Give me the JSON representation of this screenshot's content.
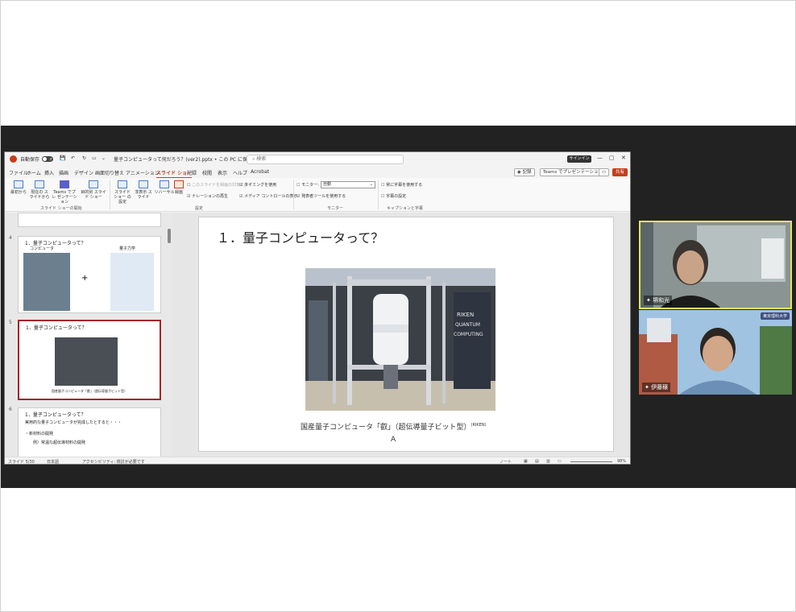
{
  "titlebar": {
    "autosave": "自動保存",
    "autosave_state": "オフ",
    "doc_title": "量子コンピュータって何だろう？(ver2).pptx • この PC に保存済み",
    "search_placeholder": "検索",
    "signin": "サインイン"
  },
  "tabs": [
    "ファイル",
    "ホーム",
    "挿入",
    "描画",
    "デザイン",
    "画面切り替え",
    "アニメーション",
    "スライド ショー",
    "記録",
    "校閲",
    "表示",
    "ヘルプ",
    "Acrobat"
  ],
  "tab_buttons": {
    "record": "記録",
    "teams": "Teams でプレゼンテーション",
    "share": "共有"
  },
  "ribbon": {
    "buttons": [
      {
        "label": "最初から"
      },
      {
        "label": "現在の スライドから"
      },
      {
        "label": "Teams でプレ ゼンテーション"
      },
      {
        "label": "目的別 スライド ショー"
      },
      {
        "label": "スライド ショー の設定"
      },
      {
        "label": "非表示 スライド"
      },
      {
        "label": "リハーサル"
      },
      {
        "label": "録画"
      }
    ],
    "checks": {
      "subtitles_dim": "このスライドを録画の対象に戻す",
      "narration": "ナレーションの再生",
      "timing": "タイミングを使用",
      "media": "メディア コントロールの表示",
      "monitor_label": "モニター:",
      "monitor_value": "自動",
      "presenter": "発表者ツールを使用する",
      "always_sub": "常に字幕を使用する",
      "sub_settings": "字幕の設定"
    },
    "groups": {
      "start": "スライド ショーの開始",
      "setup": "設定",
      "monitor": "モニター",
      "caption": "キャプションと字幕"
    }
  },
  "thumbnails": [
    {
      "num": "4",
      "title": "1．量子コンピュータって？",
      "left_label": "コンピュータ",
      "right_label": "量子力学"
    },
    {
      "num": "5",
      "title": "1．量子コンピュータって？",
      "caption": "国産量子コンピュータ「叡」（超伝導量子ビット型）"
    },
    {
      "num": "6",
      "title": "1．量子コンピュータって？",
      "line1": "実用的な量子コンピュータが完成したとすると・・・",
      "line2": "・新材料の開発",
      "line3": "例）常温な超伝導材料の開発"
    }
  ],
  "slide": {
    "title": "１．量子コンピュータって？",
    "photo_text": "RIKEN QUANTUM COMPUTING",
    "caption": "国産量子コンピュータ「叡」（超伝導量子ビット型）",
    "caption_source": "(RIKEN)",
    "caption_extra": "A"
  },
  "status": {
    "slide_count": "スライド 5/30",
    "language": "日本語",
    "accessibility": "アクセシビリティ: 検討が必要です",
    "notes": "ノート",
    "zoom": "98%"
  },
  "participants": [
    {
      "name": "堺和光"
    },
    {
      "name": "伊藤穣",
      "badge": "東京理科大学"
    }
  ],
  "colors": {
    "accent": "#b7472a",
    "selected_thumb": "#a4262c",
    "active_speaker": "#e5e55c",
    "meeting_bg": "#222222"
  }
}
